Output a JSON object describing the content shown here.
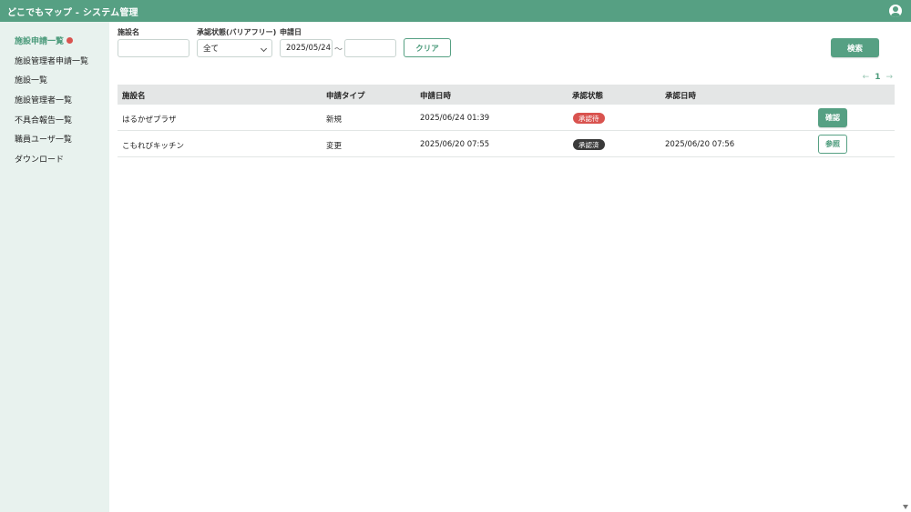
{
  "header": {
    "title": "どこでもマップ - システム管理",
    "user_icon": "user-circle-icon"
  },
  "sidebar": {
    "items": [
      {
        "label": "施設申請一覧",
        "active": true,
        "badge": true
      },
      {
        "label": "施設管理者申請一覧"
      },
      {
        "label": "施設一覧"
      },
      {
        "label": "施設管理者一覧"
      },
      {
        "label": "不具合報告一覧"
      },
      {
        "label": "職員ユーザ一覧"
      },
      {
        "label": "ダウンロード"
      }
    ]
  },
  "filters": {
    "facility_name": {
      "label": "施設名",
      "value": ""
    },
    "status": {
      "label": "承認状態(バリアフリー)",
      "value": "全て"
    },
    "date": {
      "label": "申請日",
      "from": "2025/05/24",
      "separator": "〜",
      "to": ""
    },
    "clear_label": "クリア",
    "search_label": "検索"
  },
  "pager": {
    "prev": "←",
    "current": "1",
    "next": "→"
  },
  "table": {
    "columns": [
      "施設名",
      "申請タイプ",
      "申請日時",
      "承認状態",
      "承認日時"
    ],
    "rows": [
      {
        "name": "はるかぜプラザ",
        "type": "新規",
        "applied_at": "2025/06/24 01:39",
        "status": "承認待",
        "approved_at": "",
        "action": "確認"
      },
      {
        "name": "こもれびキッチン",
        "type": "変更",
        "applied_at": "2025/06/20 07:55",
        "status": "承認済",
        "approved_at": "2025/06/20 07:56",
        "action": "参照"
      }
    ]
  },
  "colors": {
    "brand": "#56a083",
    "sidebar_bg": "#e8f2ee",
    "pending": "#d9534f",
    "approved": "#3a3a3a"
  }
}
